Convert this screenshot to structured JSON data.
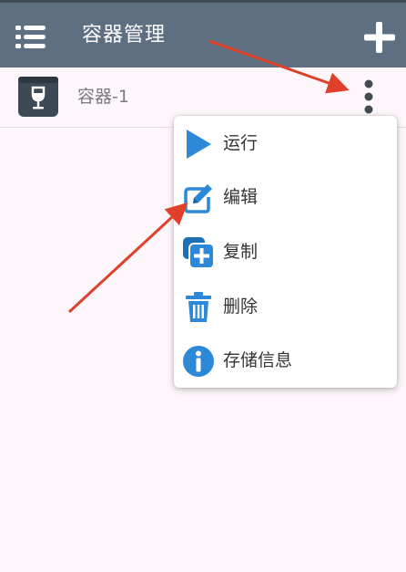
{
  "app": {
    "title": "容器管理"
  },
  "containers": [
    {
      "name": "容器-1"
    }
  ],
  "menu": {
    "items": [
      {
        "label": "运行",
        "icon": "play-icon"
      },
      {
        "label": "编辑",
        "icon": "edit-icon"
      },
      {
        "label": "复制",
        "icon": "copy-icon"
      },
      {
        "label": "删除",
        "icon": "trash-icon"
      },
      {
        "label": "存储信息",
        "icon": "info-icon"
      }
    ]
  },
  "colors": {
    "appbar": "#5d6f80",
    "accent": "#2d88d8",
    "annotation": "#e0402a"
  }
}
